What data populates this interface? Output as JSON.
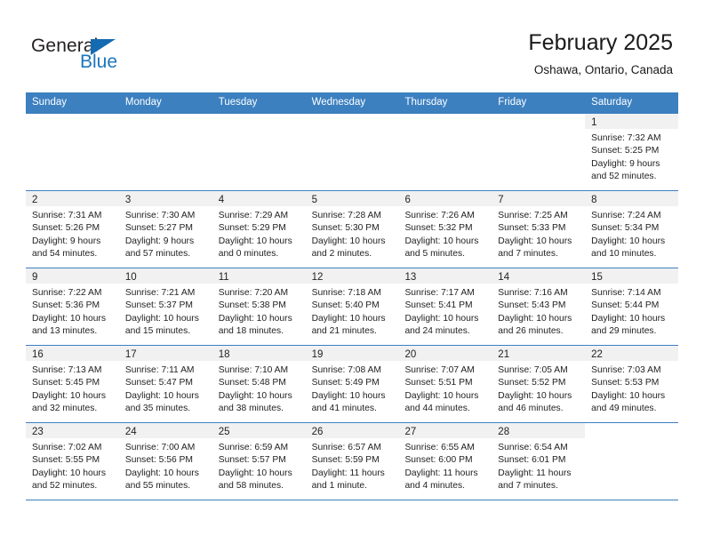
{
  "brand": {
    "name_top": "General",
    "name_bottom": "Blue",
    "triangle_color": "#156bb1",
    "blue_color": "#1b75bb"
  },
  "header": {
    "title": "February 2025",
    "subtitle": "Oshawa, Ontario, Canada"
  },
  "theme": {
    "header_bg": "#3c80c0",
    "daynum_band_bg": "#f1f1f1",
    "row_border": "#3c80c0"
  },
  "weekdays": [
    "Sunday",
    "Monday",
    "Tuesday",
    "Wednesday",
    "Thursday",
    "Friday",
    "Saturday"
  ],
  "weeks": [
    [
      {
        "day": "",
        "lines": []
      },
      {
        "day": "",
        "lines": []
      },
      {
        "day": "",
        "lines": []
      },
      {
        "day": "",
        "lines": []
      },
      {
        "day": "",
        "lines": []
      },
      {
        "day": "",
        "lines": []
      },
      {
        "day": "1",
        "lines": [
          "Sunrise: 7:32 AM",
          "Sunset: 5:25 PM",
          "Daylight: 9 hours",
          "and 52 minutes."
        ]
      }
    ],
    [
      {
        "day": "2",
        "lines": [
          "Sunrise: 7:31 AM",
          "Sunset: 5:26 PM",
          "Daylight: 9 hours",
          "and 54 minutes."
        ]
      },
      {
        "day": "3",
        "lines": [
          "Sunrise: 7:30 AM",
          "Sunset: 5:27 PM",
          "Daylight: 9 hours",
          "and 57 minutes."
        ]
      },
      {
        "day": "4",
        "lines": [
          "Sunrise: 7:29 AM",
          "Sunset: 5:29 PM",
          "Daylight: 10 hours",
          "and 0 minutes."
        ]
      },
      {
        "day": "5",
        "lines": [
          "Sunrise: 7:28 AM",
          "Sunset: 5:30 PM",
          "Daylight: 10 hours",
          "and 2 minutes."
        ]
      },
      {
        "day": "6",
        "lines": [
          "Sunrise: 7:26 AM",
          "Sunset: 5:32 PM",
          "Daylight: 10 hours",
          "and 5 minutes."
        ]
      },
      {
        "day": "7",
        "lines": [
          "Sunrise: 7:25 AM",
          "Sunset: 5:33 PM",
          "Daylight: 10 hours",
          "and 7 minutes."
        ]
      },
      {
        "day": "8",
        "lines": [
          "Sunrise: 7:24 AM",
          "Sunset: 5:34 PM",
          "Daylight: 10 hours",
          "and 10 minutes."
        ]
      }
    ],
    [
      {
        "day": "9",
        "lines": [
          "Sunrise: 7:22 AM",
          "Sunset: 5:36 PM",
          "Daylight: 10 hours",
          "and 13 minutes."
        ]
      },
      {
        "day": "10",
        "lines": [
          "Sunrise: 7:21 AM",
          "Sunset: 5:37 PM",
          "Daylight: 10 hours",
          "and 15 minutes."
        ]
      },
      {
        "day": "11",
        "lines": [
          "Sunrise: 7:20 AM",
          "Sunset: 5:38 PM",
          "Daylight: 10 hours",
          "and 18 minutes."
        ]
      },
      {
        "day": "12",
        "lines": [
          "Sunrise: 7:18 AM",
          "Sunset: 5:40 PM",
          "Daylight: 10 hours",
          "and 21 minutes."
        ]
      },
      {
        "day": "13",
        "lines": [
          "Sunrise: 7:17 AM",
          "Sunset: 5:41 PM",
          "Daylight: 10 hours",
          "and 24 minutes."
        ]
      },
      {
        "day": "14",
        "lines": [
          "Sunrise: 7:16 AM",
          "Sunset: 5:43 PM",
          "Daylight: 10 hours",
          "and 26 minutes."
        ]
      },
      {
        "day": "15",
        "lines": [
          "Sunrise: 7:14 AM",
          "Sunset: 5:44 PM",
          "Daylight: 10 hours",
          "and 29 minutes."
        ]
      }
    ],
    [
      {
        "day": "16",
        "lines": [
          "Sunrise: 7:13 AM",
          "Sunset: 5:45 PM",
          "Daylight: 10 hours",
          "and 32 minutes."
        ]
      },
      {
        "day": "17",
        "lines": [
          "Sunrise: 7:11 AM",
          "Sunset: 5:47 PM",
          "Daylight: 10 hours",
          "and 35 minutes."
        ]
      },
      {
        "day": "18",
        "lines": [
          "Sunrise: 7:10 AM",
          "Sunset: 5:48 PM",
          "Daylight: 10 hours",
          "and 38 minutes."
        ]
      },
      {
        "day": "19",
        "lines": [
          "Sunrise: 7:08 AM",
          "Sunset: 5:49 PM",
          "Daylight: 10 hours",
          "and 41 minutes."
        ]
      },
      {
        "day": "20",
        "lines": [
          "Sunrise: 7:07 AM",
          "Sunset: 5:51 PM",
          "Daylight: 10 hours",
          "and 44 minutes."
        ]
      },
      {
        "day": "21",
        "lines": [
          "Sunrise: 7:05 AM",
          "Sunset: 5:52 PM",
          "Daylight: 10 hours",
          "and 46 minutes."
        ]
      },
      {
        "day": "22",
        "lines": [
          "Sunrise: 7:03 AM",
          "Sunset: 5:53 PM",
          "Daylight: 10 hours",
          "and 49 minutes."
        ]
      }
    ],
    [
      {
        "day": "23",
        "lines": [
          "Sunrise: 7:02 AM",
          "Sunset: 5:55 PM",
          "Daylight: 10 hours",
          "and 52 minutes."
        ]
      },
      {
        "day": "24",
        "lines": [
          "Sunrise: 7:00 AM",
          "Sunset: 5:56 PM",
          "Daylight: 10 hours",
          "and 55 minutes."
        ]
      },
      {
        "day": "25",
        "lines": [
          "Sunrise: 6:59 AM",
          "Sunset: 5:57 PM",
          "Daylight: 10 hours",
          "and 58 minutes."
        ]
      },
      {
        "day": "26",
        "lines": [
          "Sunrise: 6:57 AM",
          "Sunset: 5:59 PM",
          "Daylight: 11 hours",
          "and 1 minute."
        ]
      },
      {
        "day": "27",
        "lines": [
          "Sunrise: 6:55 AM",
          "Sunset: 6:00 PM",
          "Daylight: 11 hours",
          "and 4 minutes."
        ]
      },
      {
        "day": "28",
        "lines": [
          "Sunrise: 6:54 AM",
          "Sunset: 6:01 PM",
          "Daylight: 11 hours",
          "and 7 minutes."
        ]
      },
      {
        "day": "",
        "lines": []
      }
    ]
  ]
}
